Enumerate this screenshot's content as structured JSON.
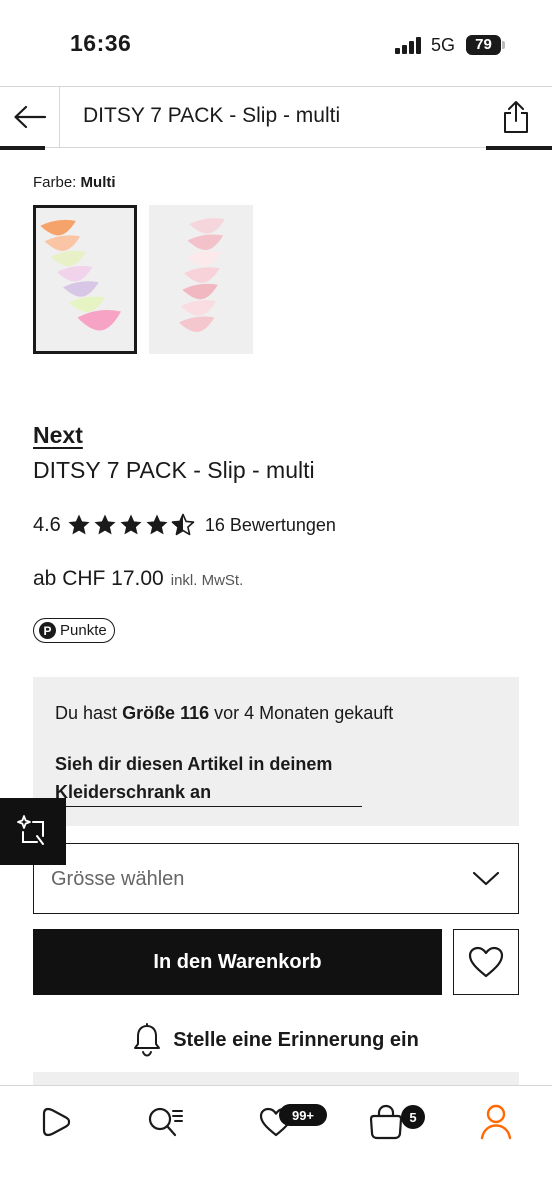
{
  "status_bar": {
    "time": "16:36",
    "network": "5G",
    "battery": "79"
  },
  "nav": {
    "title": "DITSY 7 PACK - Slip - multi"
  },
  "color": {
    "label": "Farbe:",
    "value": "Multi"
  },
  "product": {
    "brand": "Next",
    "name": "DITSY 7 PACK - Slip - multi",
    "rating": "4.6",
    "rating_stars": 4.5,
    "reviews": "16 Bewertungen",
    "price": "ab CHF 17.00",
    "vat": "inkl. MwSt.",
    "points": "Punkte",
    "points_icon": "P"
  },
  "purchase_info": {
    "prefix": "Du hast",
    "size": "Größe 116",
    "suffix": "vor 4 Monaten gekauft",
    "link": "Sieh dir diesen Artikel in deinem Kleiderschrank an"
  },
  "size_select": {
    "placeholder": "Grösse wählen"
  },
  "actions": {
    "add_to_cart": "In den Warenkorb",
    "reminder": "Stelle eine Erinnerung ein"
  },
  "tabbar": {
    "tabs": [
      {
        "name": "home",
        "icon": "play-icon"
      },
      {
        "name": "search",
        "icon": "search-icon"
      },
      {
        "name": "wishlist",
        "icon": "heart-icon",
        "badge": "99+"
      },
      {
        "name": "bag",
        "icon": "bag-icon",
        "badge": "5"
      },
      {
        "name": "account",
        "icon": "user-icon"
      }
    ]
  },
  "colors": {
    "accent": "#ff6900",
    "text": "#1a1a1a",
    "panel": "#efefef"
  }
}
